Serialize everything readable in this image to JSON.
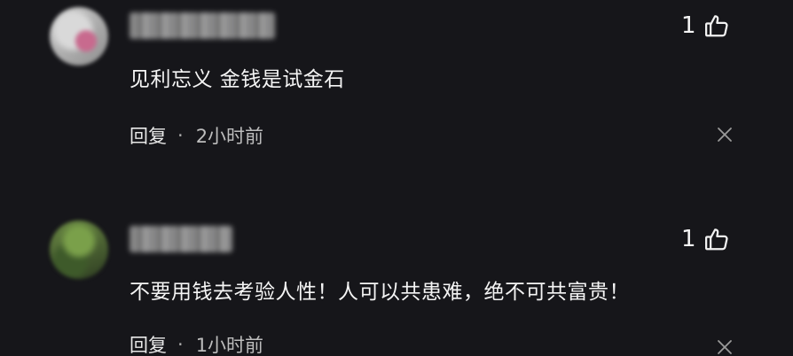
{
  "comments": [
    {
      "like_count": "1",
      "text": "见利忘义 金钱是试金石",
      "reply_label": "回复",
      "separator": "·",
      "timestamp": "2小时前",
      "icons": {
        "like": "thumbs-up-icon",
        "close": "close-icon"
      }
    },
    {
      "like_count": "1",
      "text": "不要用钱去考验人性！人可以共患难，绝不可共富贵！",
      "reply_label": "回复",
      "separator": "·",
      "timestamp": "1小时前",
      "icons": {
        "like": "thumbs-up-icon",
        "close": "close-icon"
      }
    }
  ],
  "colors": {
    "background": "#16161a",
    "text": "#f5f5f5",
    "meta": "#bdbdbd"
  }
}
